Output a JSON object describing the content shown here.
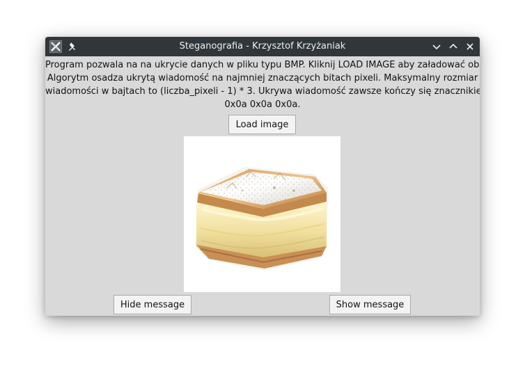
{
  "window": {
    "title": "Steganografia - Krzysztof Krzyżaniak"
  },
  "description": {
    "lines": [
      "Program pozwala na na ukrycie danych w pliku typu BMP. Kliknij LOAD IMAGE aby załadować obrazek!",
      "Algorytm osadza ukrytą wiadomość na najmniej znaczących bitach pixeli. Maksymalny rozmiar",
      "wiadomości w bajtach to (liczba_pixeli - 1) * 3. Ukrywa wiadomość zawsze kończy się znacznikiem",
      "0x0a 0x0a 0x0a."
    ]
  },
  "buttons": {
    "load_image": "Load image",
    "hide_message": "Hide message",
    "show_message": "Show message"
  },
  "icons": {
    "app": "x-window-icon",
    "pin": "pin-icon",
    "minimize": "chevron-down-icon",
    "maximize": "chevron-up-icon",
    "close": "close-icon"
  },
  "colors": {
    "titlebar": "#31363b",
    "window_background": "#d9d9d9",
    "button_background": "#f3f3f3"
  }
}
